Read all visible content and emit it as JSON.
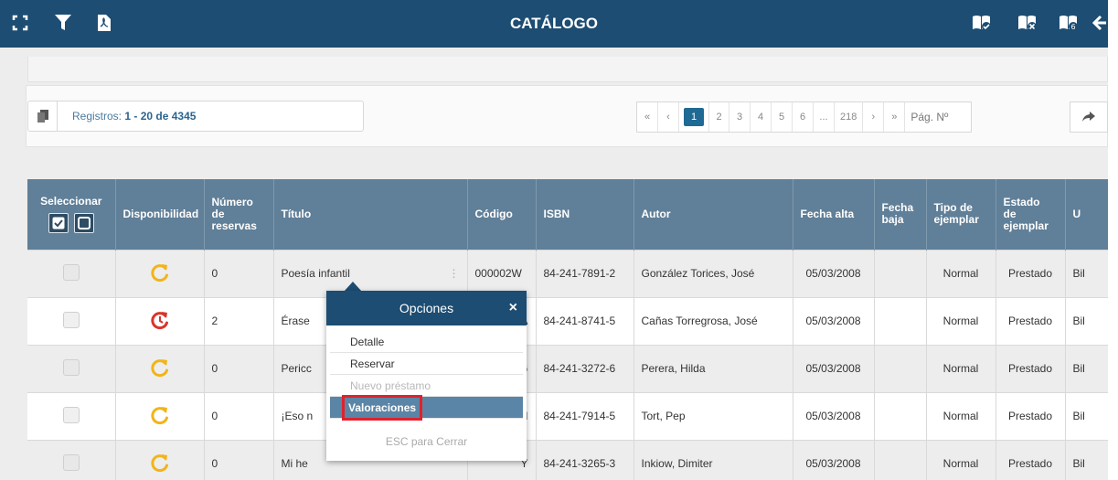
{
  "header": {
    "title": "CATÁLOGO",
    "left_icons": [
      "fullscreen-icon",
      "filter-icon",
      "pdf-icon"
    ],
    "right_icons": [
      "book-check-icon",
      "book-cancel-icon",
      "book-number-icon",
      "back-arrow-icon"
    ]
  },
  "records": {
    "prefix": "Registros:",
    "range": "1 - 20 de 4345"
  },
  "pager": {
    "first": "«",
    "prev": "‹",
    "pages": [
      "1",
      "2",
      "3",
      "4",
      "5",
      "6",
      "...",
      "218"
    ],
    "next": "›",
    "last": "»",
    "page_input_placeholder": "Pág. Nº"
  },
  "table": {
    "columns": [
      "Seleccionar",
      "Disponibilidad",
      "Número de reservas",
      "Título",
      "Código",
      "ISBN",
      "Autor",
      "Fecha alta",
      "Fecha baja",
      "Tipo de ejemplar",
      "Estado de ejemplar",
      "U"
    ],
    "rows": [
      {
        "reservas": "0",
        "titulo": "Poesía infantil",
        "codigo": "000002W",
        "isbn": "84-241-7891-2",
        "autor": "González Torices, José",
        "alta": "05/03/2008",
        "baja": "",
        "tipo": "Normal",
        "estado": "Prestado",
        "u": "Bil",
        "availability": "available"
      },
      {
        "reservas": "2",
        "titulo": "Érase",
        "codigo": "A",
        "isbn": "84-241-8741-5",
        "autor": "Cañas Torregrosa, José",
        "alta": "05/03/2008",
        "baja": "",
        "tipo": "Normal",
        "estado": "Prestado",
        "u": "Bil",
        "availability": "reserved"
      },
      {
        "reservas": "0",
        "titulo": "Pericc",
        "codigo": "G",
        "isbn": "84-241-3272-6",
        "autor": "Perera, Hilda",
        "alta": "05/03/2008",
        "baja": "",
        "tipo": "Normal",
        "estado": "Prestado",
        "u": "Bil",
        "availability": "available"
      },
      {
        "reservas": "0",
        "titulo": "¡Eso n",
        "codigo": "M",
        "isbn": "84-241-7914-5",
        "autor": "Tort, Pep",
        "alta": "05/03/2008",
        "baja": "",
        "tipo": "Normal",
        "estado": "Prestado",
        "u": "Bil",
        "availability": "available"
      },
      {
        "reservas": "0",
        "titulo": "Mi he",
        "codigo": "Y",
        "isbn": "84-241-3265-3",
        "autor": "Inkiow, Dimiter",
        "alta": "05/03/2008",
        "baja": "",
        "tipo": "Normal",
        "estado": "Prestado",
        "u": "Bil",
        "availability": "available"
      }
    ]
  },
  "popup": {
    "title": "Opciones",
    "close": "×",
    "items": [
      {
        "label": "Detalle",
        "state": "normal"
      },
      {
        "label": "Reservar",
        "state": "normal"
      },
      {
        "label": "Nuevo préstamo",
        "state": "disabled"
      },
      {
        "label": "Valoraciones",
        "state": "highlighted"
      }
    ],
    "esc": "ESC para Cerrar"
  },
  "colors": {
    "header_bg": "#1d4d72",
    "table_header_bg": "#607f98",
    "available_icon": "#f2b418",
    "reserved_icon": "#d9342b",
    "highlight_border": "#e0212d"
  }
}
